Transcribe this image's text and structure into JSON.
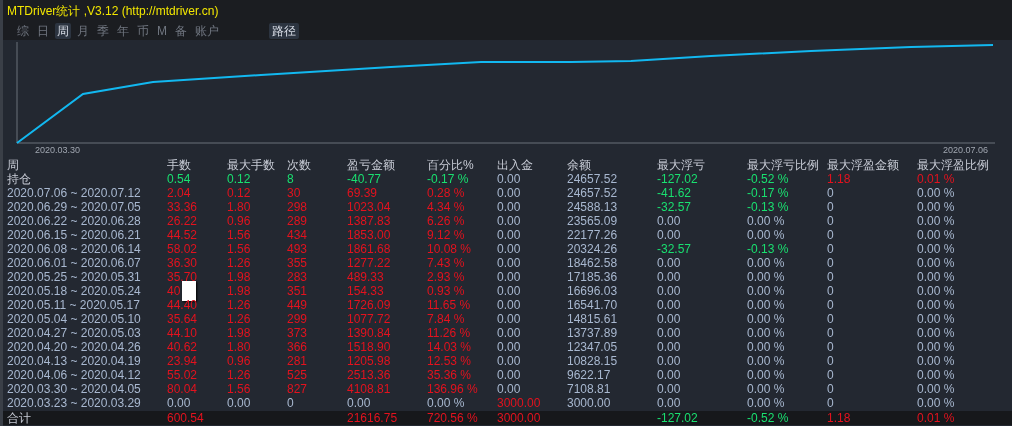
{
  "window": {
    "title": "MTDriver统计 ,V3.12 (http://mtdriver.cn)"
  },
  "tabs": [
    {
      "label": "综",
      "selected": false
    },
    {
      "label": "日",
      "selected": false
    },
    {
      "label": "周",
      "selected": true
    },
    {
      "label": "月",
      "selected": false
    },
    {
      "label": "季",
      "selected": false
    },
    {
      "label": "年",
      "selected": false
    },
    {
      "label": "币",
      "selected": false
    },
    {
      "label": "M",
      "selected": false
    },
    {
      "label": "备",
      "selected": false
    },
    {
      "label": "账户",
      "selected": false
    }
  ],
  "path_button": {
    "label": "路径",
    "selected": true
  },
  "chart": {
    "start_label": "2020.03.30",
    "end_label": "2020.07.06"
  },
  "table": {
    "columns": [
      "周",
      "手数",
      "最大手数",
      "次数",
      "盈亏金额",
      "百分比%",
      "出入金",
      "余额",
      "最大浮亏",
      "最大浮亏比例",
      "最大浮盈金额",
      "最大浮盈比例"
    ],
    "rows": [
      {
        "kind": "position",
        "cells": [
          {
            "text": "持仓"
          },
          {
            "text": "0.54",
            "color": "#19e070"
          },
          {
            "text": "0.12",
            "color": "#19e070"
          },
          {
            "text": "8",
            "color": "#19e070"
          },
          {
            "text": "-40.77",
            "color": "#19e070"
          },
          {
            "text": "-0.17 %",
            "color": "#19e070"
          },
          {
            "text": "0.00",
            "color": "#a8b8d0"
          },
          {
            "text": "24657.52",
            "color": "#a8b8d0"
          },
          {
            "text": "-127.02",
            "color": "#19e070"
          },
          {
            "text": "-0.52 %",
            "color": "#19e070"
          },
          {
            "text": "1.18",
            "color": "#e3121e"
          },
          {
            "text": "0.01 %",
            "color": "#e3121e"
          }
        ]
      },
      {
        "kind": "week",
        "cells": [
          {
            "text": "2020.07.06 ~ 2020.07.12",
            "color": "#a8b8d0"
          },
          {
            "text": "2.04",
            "color": "#e3121e"
          },
          {
            "text": "0.12",
            "color": "#e3121e"
          },
          {
            "text": "30",
            "color": "#e3121e"
          },
          {
            "text": "69.39",
            "color": "#e3121e"
          },
          {
            "text": "0.28 %",
            "color": "#e3121e"
          },
          {
            "text": "0.00",
            "color": "#a8b8d0"
          },
          {
            "text": "24657.52",
            "color": "#a8b8d0"
          },
          {
            "text": "-41.62",
            "color": "#19e070"
          },
          {
            "text": "-0.17 %",
            "color": "#19e070"
          },
          {
            "text": "0",
            "color": "#a8b8d0"
          },
          {
            "text": "0.00 %",
            "color": "#a8b8d0"
          }
        ]
      },
      {
        "kind": "week",
        "cells": [
          {
            "text": "2020.06.29 ~ 2020.07.05",
            "color": "#a8b8d0"
          },
          {
            "text": "33.36",
            "color": "#e3121e"
          },
          {
            "text": "1.80",
            "color": "#e3121e"
          },
          {
            "text": "298",
            "color": "#e3121e"
          },
          {
            "text": "1023.04",
            "color": "#e3121e"
          },
          {
            "text": "4.34 %",
            "color": "#e3121e"
          },
          {
            "text": "0.00",
            "color": "#a8b8d0"
          },
          {
            "text": "24588.13",
            "color": "#a8b8d0"
          },
          {
            "text": "-32.57",
            "color": "#19e070"
          },
          {
            "text": "-0.13 %",
            "color": "#19e070"
          },
          {
            "text": "0",
            "color": "#a8b8d0"
          },
          {
            "text": "0.00 %",
            "color": "#a8b8d0"
          }
        ]
      },
      {
        "kind": "week",
        "cells": [
          {
            "text": "2020.06.22 ~ 2020.06.28",
            "color": "#a8b8d0"
          },
          {
            "text": "26.22",
            "color": "#e3121e"
          },
          {
            "text": "0.96",
            "color": "#e3121e"
          },
          {
            "text": "289",
            "color": "#e3121e"
          },
          {
            "text": "1387.83",
            "color": "#e3121e"
          },
          {
            "text": "6.26 %",
            "color": "#e3121e"
          },
          {
            "text": "0.00",
            "color": "#a8b8d0"
          },
          {
            "text": "23565.09",
            "color": "#a8b8d0"
          },
          {
            "text": "0.00",
            "color": "#a8b8d0"
          },
          {
            "text": "0.00 %",
            "color": "#a8b8d0"
          },
          {
            "text": "0",
            "color": "#a8b8d0"
          },
          {
            "text": "0.00 %",
            "color": "#a8b8d0"
          }
        ]
      },
      {
        "kind": "week",
        "cells": [
          {
            "text": "2020.06.15 ~ 2020.06.21",
            "color": "#a8b8d0"
          },
          {
            "text": "44.52",
            "color": "#e3121e"
          },
          {
            "text": "1.56",
            "color": "#e3121e"
          },
          {
            "text": "434",
            "color": "#e3121e"
          },
          {
            "text": "1853.00",
            "color": "#e3121e"
          },
          {
            "text": "9.12 %",
            "color": "#e3121e"
          },
          {
            "text": "0.00",
            "color": "#a8b8d0"
          },
          {
            "text": "22177.26",
            "color": "#a8b8d0"
          },
          {
            "text": "0.00",
            "color": "#a8b8d0"
          },
          {
            "text": "0.00 %",
            "color": "#a8b8d0"
          },
          {
            "text": "0",
            "color": "#a8b8d0"
          },
          {
            "text": "0.00 %",
            "color": "#a8b8d0"
          }
        ]
      },
      {
        "kind": "week",
        "cells": [
          {
            "text": "2020.06.08 ~ 2020.06.14",
            "color": "#a8b8d0"
          },
          {
            "text": "58.02",
            "color": "#e3121e"
          },
          {
            "text": "1.56",
            "color": "#e3121e"
          },
          {
            "text": "493",
            "color": "#e3121e"
          },
          {
            "text": "1861.68",
            "color": "#e3121e"
          },
          {
            "text": "10.08 %",
            "color": "#e3121e"
          },
          {
            "text": "0.00",
            "color": "#a8b8d0"
          },
          {
            "text": "20324.26",
            "color": "#a8b8d0"
          },
          {
            "text": "-32.57",
            "color": "#19e070"
          },
          {
            "text": "-0.13 %",
            "color": "#19e070"
          },
          {
            "text": "0",
            "color": "#a8b8d0"
          },
          {
            "text": "0.00 %",
            "color": "#a8b8d0"
          }
        ]
      },
      {
        "kind": "week",
        "cells": [
          {
            "text": "2020.06.01 ~ 2020.06.07",
            "color": "#a8b8d0"
          },
          {
            "text": "36.30",
            "color": "#e3121e"
          },
          {
            "text": "1.26",
            "color": "#e3121e"
          },
          {
            "text": "355",
            "color": "#e3121e"
          },
          {
            "text": "1277.22",
            "color": "#e3121e"
          },
          {
            "text": "7.43 %",
            "color": "#e3121e"
          },
          {
            "text": "0.00",
            "color": "#a8b8d0"
          },
          {
            "text": "18462.58",
            "color": "#a8b8d0"
          },
          {
            "text": "0.00",
            "color": "#a8b8d0"
          },
          {
            "text": "0.00 %",
            "color": "#a8b8d0"
          },
          {
            "text": "0",
            "color": "#a8b8d0"
          },
          {
            "text": "0.00 %",
            "color": "#a8b8d0"
          }
        ]
      },
      {
        "kind": "week",
        "cells": [
          {
            "text": "2020.05.25 ~ 2020.05.31",
            "color": "#a8b8d0"
          },
          {
            "text": "35.70",
            "color": "#e3121e"
          },
          {
            "text": "1.98",
            "color": "#e3121e"
          },
          {
            "text": "283",
            "color": "#e3121e"
          },
          {
            "text": "489.33",
            "color": "#e3121e"
          },
          {
            "text": "2.93 %",
            "color": "#e3121e"
          },
          {
            "text": "0.00",
            "color": "#a8b8d0"
          },
          {
            "text": "17185.36",
            "color": "#a8b8d0"
          },
          {
            "text": "0.00",
            "color": "#a8b8d0"
          },
          {
            "text": "0.00 %",
            "color": "#a8b8d0"
          },
          {
            "text": "0",
            "color": "#a8b8d0"
          },
          {
            "text": "0.00 %",
            "color": "#a8b8d0"
          }
        ]
      },
      {
        "kind": "week",
        "covered": true,
        "cells": [
          {
            "text": "2020.05.18 ~ 2020.05.24",
            "color": "#a8b8d0"
          },
          {
            "text": "40",
            "color": "#e3121e"
          },
          {
            "text": "1.98",
            "color": "#e3121e"
          },
          {
            "text": "351",
            "color": "#e3121e"
          },
          {
            "text": "154.33",
            "color": "#e3121e"
          },
          {
            "text": "0.93 %",
            "color": "#e3121e"
          },
          {
            "text": "0.00",
            "color": "#a8b8d0"
          },
          {
            "text": "16696.03",
            "color": "#a8b8d0"
          },
          {
            "text": "0.00",
            "color": "#a8b8d0"
          },
          {
            "text": "0.00 %",
            "color": "#a8b8d0"
          },
          {
            "text": "0",
            "color": "#a8b8d0"
          },
          {
            "text": "0.00 %",
            "color": "#a8b8d0"
          }
        ]
      },
      {
        "kind": "week",
        "cells": [
          {
            "text": "2020.05.11 ~ 2020.05.17",
            "color": "#a8b8d0"
          },
          {
            "text": "44.40",
            "color": "#e3121e"
          },
          {
            "text": "1.26",
            "color": "#e3121e"
          },
          {
            "text": "449",
            "color": "#e3121e"
          },
          {
            "text": "1726.09",
            "color": "#e3121e"
          },
          {
            "text": "11.65 %",
            "color": "#e3121e"
          },
          {
            "text": "0.00",
            "color": "#a8b8d0"
          },
          {
            "text": "16541.70",
            "color": "#a8b8d0"
          },
          {
            "text": "0.00",
            "color": "#a8b8d0"
          },
          {
            "text": "0.00 %",
            "color": "#a8b8d0"
          },
          {
            "text": "0",
            "color": "#a8b8d0"
          },
          {
            "text": "0.00 %",
            "color": "#a8b8d0"
          }
        ]
      },
      {
        "kind": "week",
        "cells": [
          {
            "text": "2020.05.04 ~ 2020.05.10",
            "color": "#a8b8d0"
          },
          {
            "text": "35.64",
            "color": "#e3121e"
          },
          {
            "text": "1.26",
            "color": "#e3121e"
          },
          {
            "text": "299",
            "color": "#e3121e"
          },
          {
            "text": "1077.72",
            "color": "#e3121e"
          },
          {
            "text": "7.84 %",
            "color": "#e3121e"
          },
          {
            "text": "0.00",
            "color": "#a8b8d0"
          },
          {
            "text": "14815.61",
            "color": "#a8b8d0"
          },
          {
            "text": "0.00",
            "color": "#a8b8d0"
          },
          {
            "text": "0.00 %",
            "color": "#a8b8d0"
          },
          {
            "text": "0",
            "color": "#a8b8d0"
          },
          {
            "text": "0.00 %",
            "color": "#a8b8d0"
          }
        ]
      },
      {
        "kind": "week",
        "cells": [
          {
            "text": "2020.04.27 ~ 2020.05.03",
            "color": "#a8b8d0"
          },
          {
            "text": "44.10",
            "color": "#e3121e"
          },
          {
            "text": "1.98",
            "color": "#e3121e"
          },
          {
            "text": "373",
            "color": "#e3121e"
          },
          {
            "text": "1390.84",
            "color": "#e3121e"
          },
          {
            "text": "11.26 %",
            "color": "#e3121e"
          },
          {
            "text": "0.00",
            "color": "#a8b8d0"
          },
          {
            "text": "13737.89",
            "color": "#a8b8d0"
          },
          {
            "text": "0.00",
            "color": "#a8b8d0"
          },
          {
            "text": "0.00 %",
            "color": "#a8b8d0"
          },
          {
            "text": "0",
            "color": "#a8b8d0"
          },
          {
            "text": "0.00 %",
            "color": "#a8b8d0"
          }
        ]
      },
      {
        "kind": "week",
        "cells": [
          {
            "text": "2020.04.20 ~ 2020.04.26",
            "color": "#a8b8d0"
          },
          {
            "text": "40.62",
            "color": "#e3121e"
          },
          {
            "text": "1.80",
            "color": "#e3121e"
          },
          {
            "text": "366",
            "color": "#e3121e"
          },
          {
            "text": "1518.90",
            "color": "#e3121e"
          },
          {
            "text": "14.03 %",
            "color": "#e3121e"
          },
          {
            "text": "0.00",
            "color": "#a8b8d0"
          },
          {
            "text": "12347.05",
            "color": "#a8b8d0"
          },
          {
            "text": "0.00",
            "color": "#a8b8d0"
          },
          {
            "text": "0.00 %",
            "color": "#a8b8d0"
          },
          {
            "text": "0",
            "color": "#a8b8d0"
          },
          {
            "text": "0.00 %",
            "color": "#a8b8d0"
          }
        ]
      },
      {
        "kind": "week",
        "cells": [
          {
            "text": "2020.04.13 ~ 2020.04.19",
            "color": "#a8b8d0"
          },
          {
            "text": "23.94",
            "color": "#e3121e"
          },
          {
            "text": "0.96",
            "color": "#e3121e"
          },
          {
            "text": "281",
            "color": "#e3121e"
          },
          {
            "text": "1205.98",
            "color": "#e3121e"
          },
          {
            "text": "12.53 %",
            "color": "#e3121e"
          },
          {
            "text": "0.00",
            "color": "#a8b8d0"
          },
          {
            "text": "10828.15",
            "color": "#a8b8d0"
          },
          {
            "text": "0.00",
            "color": "#a8b8d0"
          },
          {
            "text": "0.00 %",
            "color": "#a8b8d0"
          },
          {
            "text": "0",
            "color": "#a8b8d0"
          },
          {
            "text": "0.00 %",
            "color": "#a8b8d0"
          }
        ]
      },
      {
        "kind": "week",
        "cells": [
          {
            "text": "2020.04.06 ~ 2020.04.12",
            "color": "#a8b8d0"
          },
          {
            "text": "55.02",
            "color": "#e3121e"
          },
          {
            "text": "1.26",
            "color": "#e3121e"
          },
          {
            "text": "525",
            "color": "#e3121e"
          },
          {
            "text": "2513.36",
            "color": "#e3121e"
          },
          {
            "text": "35.36 %",
            "color": "#e3121e"
          },
          {
            "text": "0.00",
            "color": "#a8b8d0"
          },
          {
            "text": "9622.17",
            "color": "#a8b8d0"
          },
          {
            "text": "0.00",
            "color": "#a8b8d0"
          },
          {
            "text": "0.00 %",
            "color": "#a8b8d0"
          },
          {
            "text": "0",
            "color": "#a8b8d0"
          },
          {
            "text": "0.00 %",
            "color": "#a8b8d0"
          }
        ]
      },
      {
        "kind": "week",
        "cells": [
          {
            "text": "2020.03.30 ~ 2020.04.05",
            "color": "#a8b8d0"
          },
          {
            "text": "80.04",
            "color": "#e3121e"
          },
          {
            "text": "1.56",
            "color": "#e3121e"
          },
          {
            "text": "827",
            "color": "#e3121e"
          },
          {
            "text": "4108.81",
            "color": "#e3121e"
          },
          {
            "text": "136.96 %",
            "color": "#e3121e"
          },
          {
            "text": "0.00",
            "color": "#a8b8d0"
          },
          {
            "text": "7108.81",
            "color": "#a8b8d0"
          },
          {
            "text": "0.00",
            "color": "#a8b8d0"
          },
          {
            "text": "0.00 %",
            "color": "#a8b8d0"
          },
          {
            "text": "0",
            "color": "#a8b8d0"
          },
          {
            "text": "0.00 %",
            "color": "#a8b8d0"
          }
        ]
      },
      {
        "kind": "week",
        "cells": [
          {
            "text": "2020.03.23 ~ 2020.03.29",
            "color": "#a8b8d0"
          },
          {
            "text": "0.00",
            "color": "#a8b8d0"
          },
          {
            "text": "0.00",
            "color": "#a8b8d0"
          },
          {
            "text": "0",
            "color": "#a8b8d0"
          },
          {
            "text": "0.00",
            "color": "#a8b8d0"
          },
          {
            "text": "0.00 %",
            "color": "#a8b8d0"
          },
          {
            "text": "3000.00",
            "color": "#e3121e"
          },
          {
            "text": "3000.00",
            "color": "#a8b8d0"
          },
          {
            "text": "0.00",
            "color": "#a8b8d0"
          },
          {
            "text": "0.00 %",
            "color": "#a8b8d0"
          },
          {
            "text": "0",
            "color": "#a8b8d0"
          },
          {
            "text": "0.00 %",
            "color": "#a8b8d0"
          }
        ]
      },
      {
        "kind": "total",
        "cells": [
          {
            "text": "合计"
          },
          {
            "text": "600.54",
            "color": "#e3121e"
          },
          {
            "text": ""
          },
          {
            "text": ""
          },
          {
            "text": "21616.75",
            "color": "#e3121e"
          },
          {
            "text": "720.56 %",
            "color": "#e3121e"
          },
          {
            "text": "3000.00",
            "color": "#e3121e"
          },
          {
            "text": ""
          },
          {
            "text": "-127.02",
            "color": "#19e070"
          },
          {
            "text": "-0.52 %",
            "color": "#19e070"
          },
          {
            "text": "1.18",
            "color": "#e3121e"
          },
          {
            "text": "0.01 %",
            "color": "#e3121e"
          }
        ]
      }
    ]
  }
}
